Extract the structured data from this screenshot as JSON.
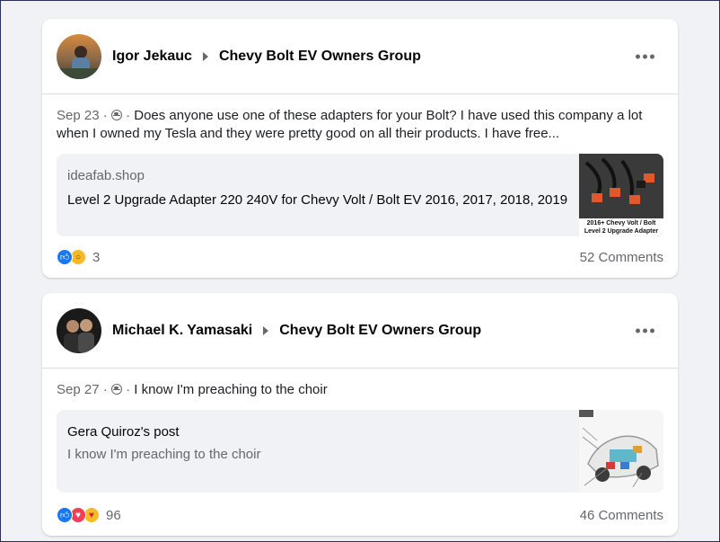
{
  "posts": [
    {
      "author": "Igor Jekauc",
      "group": "Chevy Bolt EV Owners Group",
      "date": "Sep 23",
      "separator": "·",
      "text": "Does anyone use one of these adapters for your Bolt? I have used this company a lot when I owned my Tesla and they were pretty good on all their products. I have free...",
      "link": {
        "domain": "ideafab.shop",
        "title": "Level 2 Upgrade Adapter 220 240V for Chevy Volt / Bolt EV 2016, 2017, 2018, 2019",
        "thumb_caption": "2016+ Chevy Volt / Bolt Level 2 Upgrade Adapter"
      },
      "reactions": [
        "like-icon",
        "wow-icon"
      ],
      "reaction_count": "3",
      "comments": "52 Comments"
    },
    {
      "author": "Michael K. Yamasaki",
      "group": "Chevy Bolt EV Owners Group",
      "date": "Sep 27",
      "separator": "·",
      "text": "I know I'm preaching to the choir",
      "shared": {
        "title": "Gera Quiroz's post",
        "text": "I know I'm preaching to the choir"
      },
      "reactions": [
        "like-icon",
        "love-icon",
        "care-icon"
      ],
      "reaction_count": "96",
      "comments": "46 Comments"
    }
  ],
  "colors": {
    "background": "#f0f2f5",
    "like": "#1877f2",
    "love": "#f33e58",
    "wow": "#f7b928",
    "muted_text": "#65676b"
  }
}
